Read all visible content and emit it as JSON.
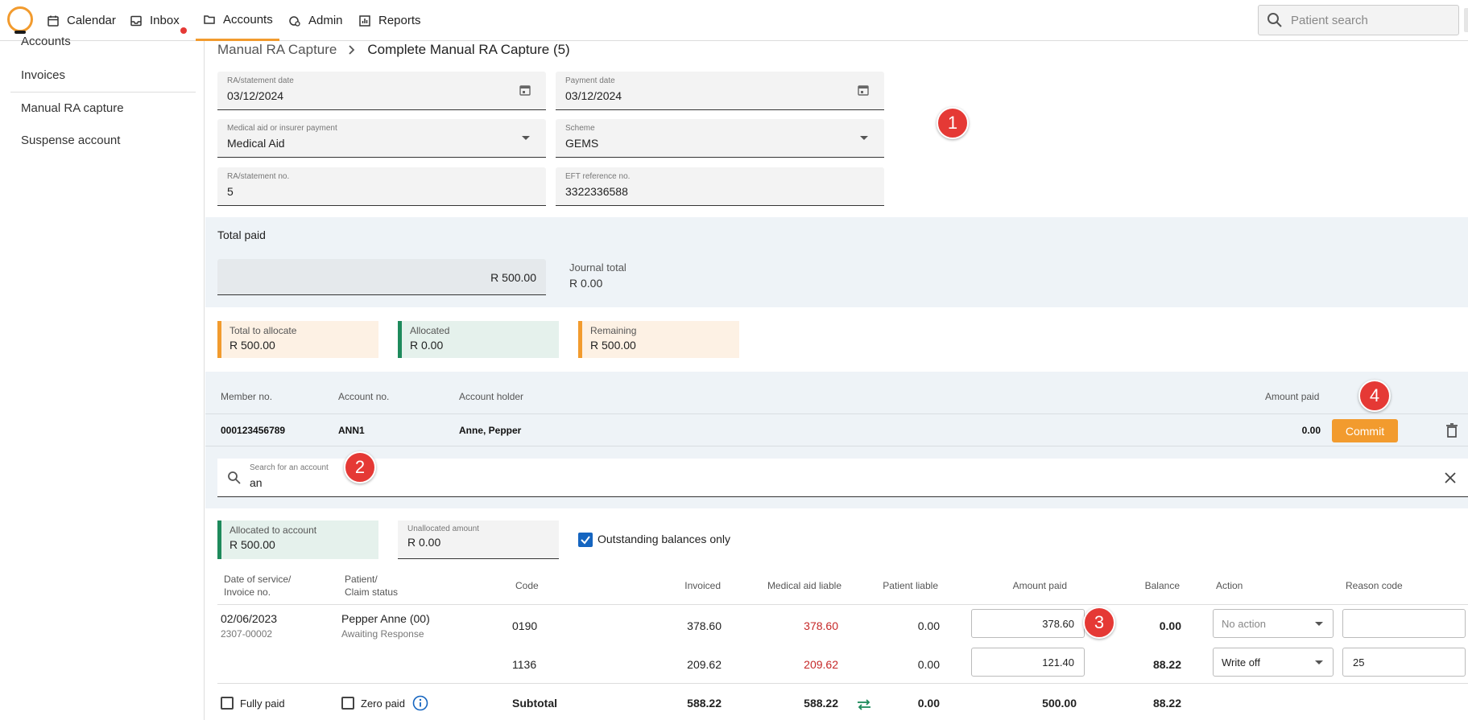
{
  "nav": {
    "items": [
      {
        "label": "Calendar",
        "icon": "calendar-icon"
      },
      {
        "label": "Inbox",
        "icon": "inbox-icon",
        "has_notification": true
      },
      {
        "label": "Accounts",
        "icon": "folder-icon",
        "active": true
      },
      {
        "label": "Admin",
        "icon": "admin-icon"
      },
      {
        "label": "Reports",
        "icon": "reports-icon"
      }
    ],
    "search_placeholder": "Patient search"
  },
  "sidebar": {
    "items": [
      {
        "label": "Accounts"
      },
      {
        "label": "Invoices"
      },
      {
        "label": "Manual RA capture"
      },
      {
        "label": "Suspense account"
      }
    ]
  },
  "breadcrumb": {
    "parent": "Manual RA Capture",
    "current": "Complete Manual RA Capture (5)"
  },
  "form": {
    "ra_date": {
      "label": "RA/statement date",
      "value": "03/12/2024"
    },
    "payment_date": {
      "label": "Payment date",
      "value": "03/12/2024"
    },
    "payer": {
      "label": "Medical aid or insurer payment",
      "value": "Medical Aid"
    },
    "scheme": {
      "label": "Scheme",
      "value": "GEMS"
    },
    "ra_no": {
      "label": "RA/statement no.",
      "value": "5"
    },
    "eft_ref": {
      "label": "EFT reference no.",
      "value": "3322336588"
    }
  },
  "markers": [
    "1",
    "2",
    "3",
    "4"
  ],
  "totals": {
    "title": "Total paid",
    "total_paid_value": "R 500.00",
    "journal_label": "Journal total",
    "journal_value": "R 0.00"
  },
  "summary_cards": [
    {
      "label": "Total to allocate",
      "value": "R 500.00"
    },
    {
      "label": "Allocated",
      "value": "R 0.00"
    },
    {
      "label": "Remaining",
      "value": "R 500.00"
    }
  ],
  "account_table": {
    "headers": {
      "member_no": "Member no.",
      "account_no": "Account no.",
      "account_holder": "Account holder",
      "amount_paid": "Amount paid"
    },
    "row": {
      "member_no": "000123456789",
      "account_no": "ANN1",
      "account_holder": "Anne, Pepper",
      "amount_paid": "0.00"
    },
    "commit_label": "Commit"
  },
  "account_search": {
    "label": "Search for an account",
    "value": "an"
  },
  "allocation": {
    "allocated_label": "Allocated to account",
    "allocated_value": "R 500.00",
    "unallocated_label": "Unallocated amount",
    "unallocated_value": "R 0.00",
    "outstanding_label": "Outstanding balances only"
  },
  "line_items": {
    "headers": {
      "date_l1": "Date of service/",
      "date_l2": "Invoice no.",
      "patient_l1": "Patient/",
      "patient_l2": "Claim status",
      "code": "Code",
      "invoiced": "Invoiced",
      "med_aid_liable": "Medical aid liable",
      "patient_liable": "Patient liable",
      "amount_paid": "Amount paid",
      "balance": "Balance",
      "action": "Action",
      "reason_code": "Reason code"
    },
    "rows": [
      {
        "date": "02/06/2023",
        "invoice": "2307-00002",
        "patient": "Pepper Anne (00)",
        "status": "Awaiting Response",
        "code": "0190",
        "invoiced": "378.60",
        "med_aid_liable": "378.60",
        "patient_liable": "0.00",
        "amount_paid": "378.60",
        "balance": "0.00",
        "action": "No action",
        "reason_code": ""
      },
      {
        "date": "",
        "invoice": "",
        "patient": "",
        "status": "",
        "code": "1136",
        "invoiced": "209.62",
        "med_aid_liable": "209.62",
        "patient_liable": "0.00",
        "amount_paid": "121.40",
        "balance": "88.22",
        "action": "Write off",
        "reason_code": "25"
      }
    ],
    "subtotal": {
      "fully_paid_label": "Fully paid",
      "zero_paid_label": "Zero paid",
      "label": "Subtotal",
      "invoiced": "588.22",
      "med_aid_liable": "588.22",
      "patient_liable": "0.00",
      "amount_paid": "500.00",
      "balance": "88.22"
    }
  },
  "colors": {
    "accent": "#f29b2e",
    "green": "#1e8a5c",
    "danger": "#e53935",
    "liable_red": "#c62828"
  }
}
